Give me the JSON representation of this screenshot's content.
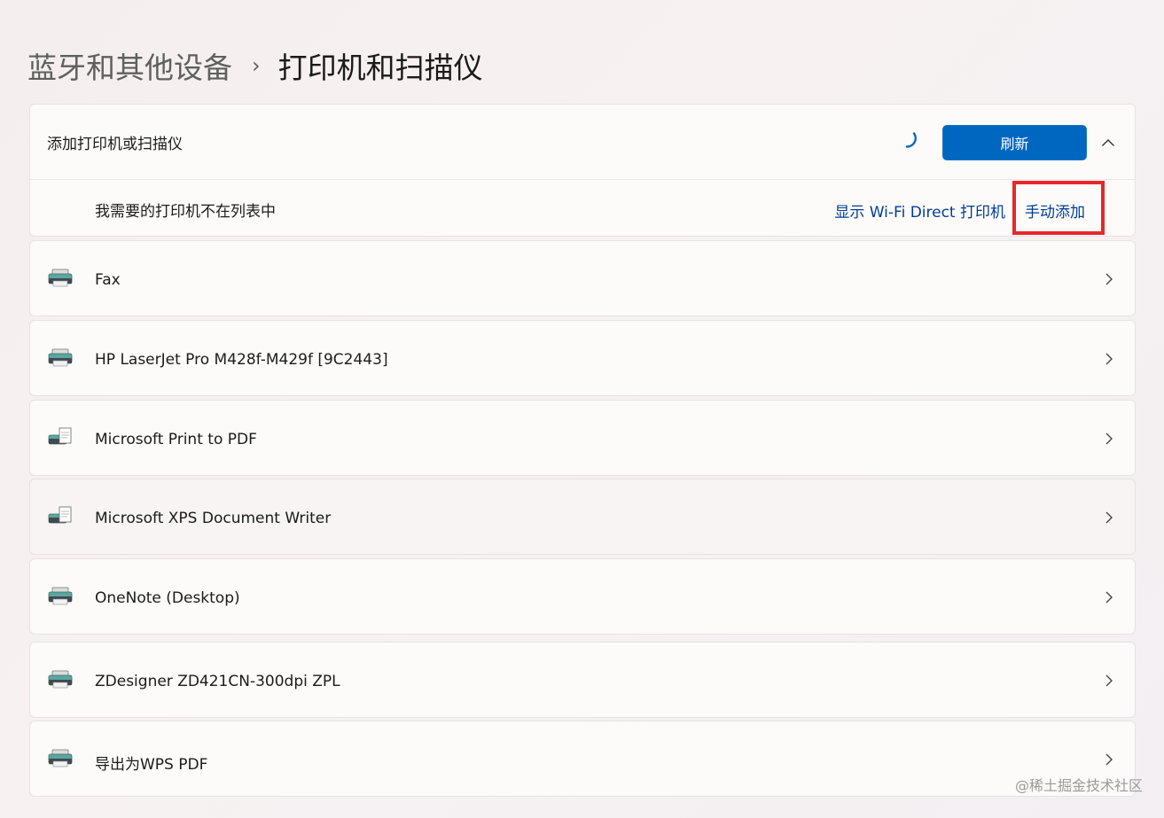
{
  "breadcrumb": {
    "parent": "蓝牙和其他设备",
    "separator": "›",
    "current": "打印机和扫描仪"
  },
  "add_section": {
    "title": "添加打印机或扫描仪",
    "refresh_label": "刷新",
    "not_listed_text": "我需要的打印机不在列表中",
    "wifi_direct_link": "显示 Wi-Fi Direct 打印机",
    "manual_add_link": "手动添加"
  },
  "printers": [
    {
      "label": "Fax",
      "icon": "printer-icon"
    },
    {
      "label": "HP LaserJet Pro M428f-M429f [9C2443]",
      "icon": "printer-icon"
    },
    {
      "label": "Microsoft Print to PDF",
      "icon": "printer-document-icon"
    },
    {
      "label": "Microsoft XPS Document Writer",
      "icon": "printer-document-icon"
    },
    {
      "label": "OneNote (Desktop)",
      "icon": "printer-icon"
    },
    {
      "label": "ZDesigner ZD421CN-300dpi ZPL",
      "icon": "printer-icon"
    },
    {
      "label": "导出为WPS PDF",
      "icon": "printer-icon"
    }
  ],
  "watermark": "@稀土掘金技术社区",
  "colors": {
    "accent": "#0067c0",
    "link": "#003e92",
    "highlight": "#e8262b"
  }
}
